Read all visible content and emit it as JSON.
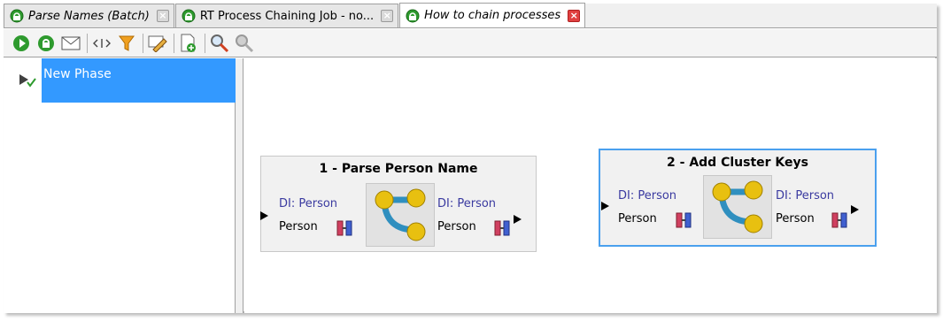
{
  "tabs": [
    {
      "label": "Parse Names (Batch)",
      "italic": true,
      "active": false
    },
    {
      "label": "RT Process Chaining Job - no...",
      "italic": false,
      "active": false
    },
    {
      "label": "How to chain processes",
      "italic": true,
      "active": true
    }
  ],
  "toolbar": {
    "icons": [
      "run-icon",
      "run-realtime-icon",
      "mail-icon",
      "step-icon",
      "filter-icon",
      "edit-label-icon",
      "new-process-icon",
      "find-icon",
      "find-disabled-icon"
    ]
  },
  "phases": [
    {
      "label": "New Phase"
    }
  ],
  "processes": [
    {
      "title": "1 - Parse Person Name",
      "input_di": "DI: Person",
      "input_name": "Person",
      "output_di": "DI: Person",
      "output_name": "Person"
    },
    {
      "title": "2 - Add Cluster Keys",
      "input_di": "DI: Person",
      "input_name": "Person",
      "output_di": "DI: Person",
      "output_name": "Person"
    }
  ],
  "colors": {
    "selection": "#3399ff",
    "selected_border": "#4aa0ee",
    "close_active": "#e04040"
  }
}
